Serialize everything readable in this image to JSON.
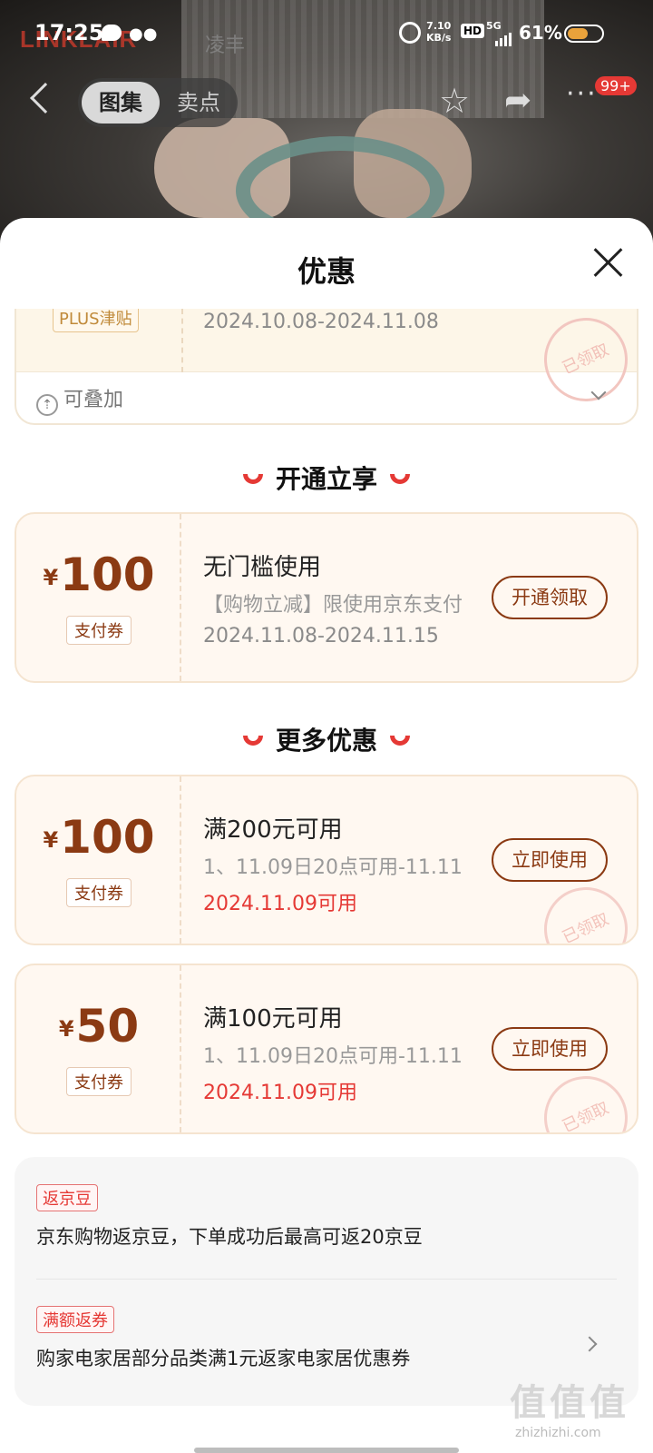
{
  "status_bar": {
    "time": "17:25",
    "net_speed_value": "7.10",
    "net_speed_unit": "KB/s",
    "hd": "HD",
    "signal": "5G",
    "battery": "61%"
  },
  "hero": {
    "brand": "LINKLAIR",
    "brand_cn": "凌丰"
  },
  "nav": {
    "tabs": [
      "图集",
      "卖点"
    ],
    "active_tab": "图集",
    "badge": "99+"
  },
  "sheet": {
    "title": "优惠",
    "partial_coupon": {
      "tag": "PLUS津贴",
      "date": "2024.10.08-2024.11.08",
      "stamp": "已领取",
      "stack_label": "可叠加"
    },
    "section1": {
      "title": "开通立享"
    },
    "coupon1": {
      "yen": "¥",
      "amount": "100",
      "type": "支付券",
      "title": "无门槛使用",
      "desc": "【购物立减】限使用京东支付",
      "date": "2024.11.08-2024.11.15",
      "button": "开通领取"
    },
    "section2": {
      "title": "更多优惠"
    },
    "coupon2": {
      "yen": "¥",
      "amount": "100",
      "type": "支付券",
      "title": "满200元可用",
      "desc": "1、11.09日20点可用-11.11",
      "date": "2024.11.09可用",
      "button": "立即使用",
      "stamp": "已领取"
    },
    "coupon3": {
      "yen": "¥",
      "amount": "50",
      "type": "支付券",
      "title": "满100元可用",
      "desc": "1、11.09日20点可用-11.11",
      "date": "2024.11.09可用",
      "button": "立即使用",
      "stamp": "已领取"
    },
    "info": {
      "row1": {
        "tag": "返京豆",
        "text": "京东购物返京豆，下单成功后最高可返20京豆"
      },
      "row2": {
        "tag": "满额返券",
        "text": "购家电家居部分品类满1元返家电家居优惠券"
      }
    }
  },
  "watermark": {
    "main": "值值值",
    "sub": "zhizhizhi.com"
  },
  "colors": {
    "accent_red": "#e53935",
    "coupon_brown": "#8b3a13",
    "coupon_bg": "#fff8f1"
  }
}
